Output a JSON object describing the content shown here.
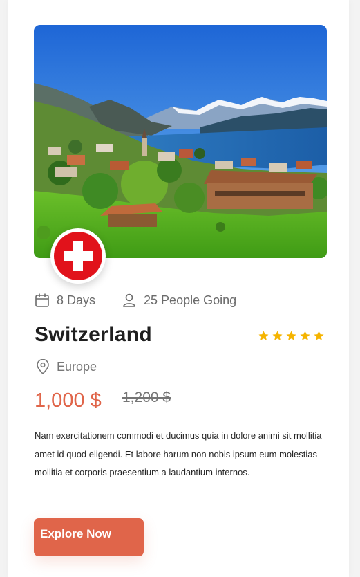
{
  "tour": {
    "duration": "8 Days",
    "people": "25 People Going",
    "title": "Switzerland",
    "rating": 5,
    "location": "Europe",
    "price": "1,000 $",
    "old_price": "1,200 $",
    "description": "Nam exercitationem commodi et ducimus quia in dolore animi sit mollitia amet id quod eligendi. Et labore harum non nobis ipsum eum molestias mollitia et corporis praesentium a laudantium internos.",
    "button_label": "Explore Now"
  },
  "colors": {
    "accent": "#e0654a",
    "star": "#f5b400",
    "flag_red": "#e1121b"
  },
  "icons": {
    "duration": "calendar-icon",
    "people": "person-icon",
    "location": "map-pin-icon",
    "badge": "swiss-flag-icon"
  }
}
